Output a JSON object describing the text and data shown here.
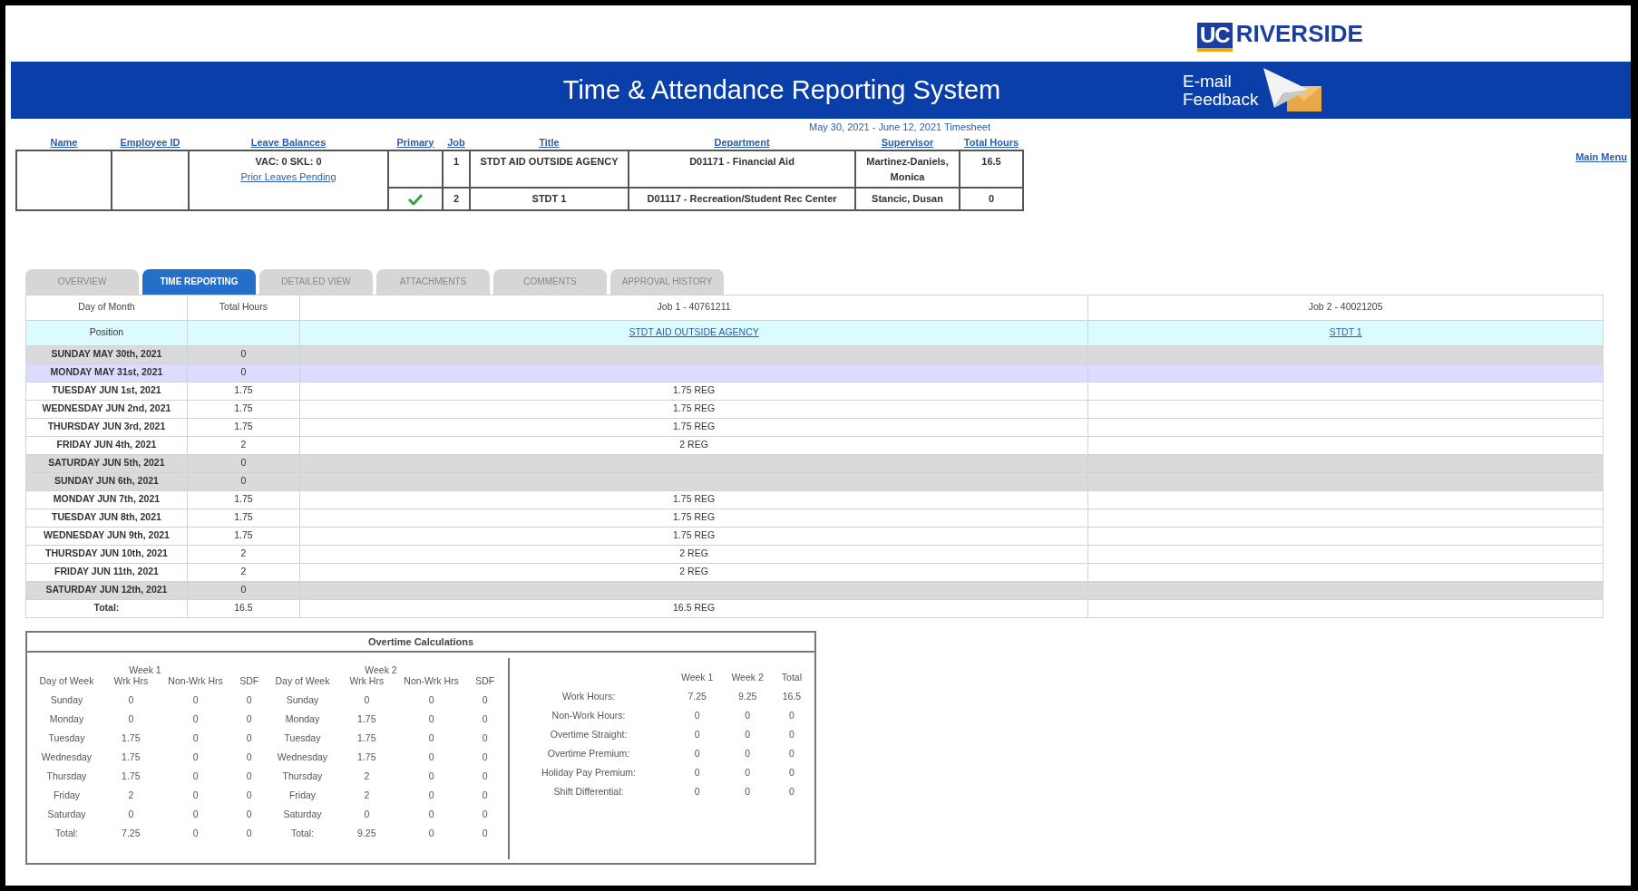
{
  "logo": {
    "mark": "UC",
    "text": "RIVERSIDE"
  },
  "banner": {
    "title": "Time & Attendance Reporting System",
    "feedback_lines": [
      "E-mail",
      "Feedback"
    ]
  },
  "period": "May 30, 2021 - June 12, 2021 Timesheet",
  "main_menu": "Main Menu",
  "employee": {
    "columns": [
      "Name",
      "Employee ID",
      "Leave Balances",
      "Primary",
      "Job",
      "Title",
      "Department",
      "Supervisor",
      "Total Hours"
    ],
    "leave_balances": {
      "text": "VAC: 0  SKL: 0",
      "link": "Prior Leaves Pending"
    },
    "jobs": [
      {
        "primary": false,
        "job": "1",
        "title": "STDT AID OUTSIDE AGENCY",
        "department": "D01171 - Financial Aid",
        "supervisor": "Martinez-Daniels, Monica",
        "total_hours": "16.5"
      },
      {
        "primary": true,
        "job": "2",
        "title": "STDT 1",
        "department": "D01117 - Recreation/Student Rec Center",
        "supervisor": "Stancic, Dusan",
        "total_hours": "0"
      }
    ]
  },
  "tabs": [
    {
      "label": "OVERVIEW",
      "selected": false
    },
    {
      "label": "TIME REPORTING",
      "selected": true
    },
    {
      "label": "DETAILED VIEW",
      "selected": false
    },
    {
      "label": "ATTACHMENTS",
      "selected": false
    },
    {
      "label": "COMMENTS",
      "selected": false
    },
    {
      "label": "APPROVAL HISTORY",
      "selected": false
    }
  ],
  "time_table": {
    "columns": [
      "Day of Month",
      "Total Hours",
      "Job 1 - 40761211",
      "Job 2 - 40021205"
    ],
    "position_row": {
      "label": "Position",
      "jobs": [
        "STDT AID OUTSIDE AGENCY",
        "STDT 1"
      ]
    },
    "rows": [
      {
        "day": "SUNDAY MAY 30th, 2021",
        "total": "0",
        "kind": "weekend",
        "selected": false
      },
      {
        "day": "MONDAY MAY 31st, 2021",
        "total": "0",
        "kind": "weekday",
        "selected": true
      },
      {
        "day": "TUESDAY JUN 1st, 2021",
        "total": "1.75",
        "job_1": "1.75 REG",
        "kind": "weekday",
        "selected": false
      },
      {
        "day": "WEDNESDAY JUN 2nd, 2021",
        "total": "1.75",
        "job_1": "1.75 REG",
        "kind": "weekday",
        "selected": false
      },
      {
        "day": "THURSDAY JUN 3rd, 2021",
        "total": "1.75",
        "job_1": "1.75 REG",
        "kind": "weekday",
        "selected": false
      },
      {
        "day": "FRIDAY JUN 4th, 2021",
        "total": "2",
        "job_1": "2 REG",
        "kind": "weekday",
        "selected": false
      },
      {
        "day": "SATURDAY JUN 5th, 2021",
        "total": "0",
        "kind": "weekend",
        "selected": false
      },
      {
        "day": "SUNDAY JUN 6th, 2021",
        "total": "0",
        "kind": "weekend",
        "selected": false
      },
      {
        "day": "MONDAY JUN 7th, 2021",
        "total": "1.75",
        "job_1": "1.75 REG",
        "kind": "weekday",
        "selected": false
      },
      {
        "day": "TUESDAY JUN 8th, 2021",
        "total": "1.75",
        "job_1": "1.75 REG",
        "kind": "weekday",
        "selected": false
      },
      {
        "day": "WEDNESDAY JUN 9th, 2021",
        "total": "1.75",
        "job_1": "1.75 REG",
        "kind": "weekday",
        "selected": false
      },
      {
        "day": "THURSDAY JUN 10th, 2021",
        "total": "2",
        "job_1": "2 REG",
        "kind": "weekday",
        "selected": false
      },
      {
        "day": "FRIDAY JUN 11th, 2021",
        "total": "2",
        "job_1": "2 REG",
        "kind": "weekday",
        "selected": false
      },
      {
        "day": "SATURDAY JUN 12th, 2021",
        "total": "0",
        "kind": "weekend",
        "selected": false
      }
    ],
    "total_row": {
      "label": "Total:",
      "total": "16.5",
      "job_1": "16.5 REG"
    }
  },
  "overtime": {
    "title": "Overtime Calculations",
    "weeks": [
      {
        "label": "Week 1",
        "columns": [
          "Day of Week",
          "Wrk Hrs",
          "Non-Wrk Hrs",
          "SDF"
        ],
        "rows": [
          [
            "Sunday",
            "0",
            "0",
            "0"
          ],
          [
            "Monday",
            "0",
            "0",
            "0"
          ],
          [
            "Tuesday",
            "1.75",
            "0",
            "0"
          ],
          [
            "Wednesday",
            "1.75",
            "0",
            "0"
          ],
          [
            "Thursday",
            "1.75",
            "0",
            "0"
          ],
          [
            "Friday",
            "2",
            "0",
            "0"
          ],
          [
            "Saturday",
            "0",
            "0",
            "0"
          ],
          [
            "Total:",
            "7.25",
            "0",
            "0"
          ]
        ]
      },
      {
        "label": "Week 2",
        "columns": [
          "Day of Week",
          "Wrk Hrs",
          "Non-Wrk Hrs",
          "SDF"
        ],
        "rows": [
          [
            "Sunday",
            "0",
            "0",
            "0"
          ],
          [
            "Monday",
            "1.75",
            "0",
            "0"
          ],
          [
            "Tuesday",
            "1.75",
            "0",
            "0"
          ],
          [
            "Wednesday",
            "1.75",
            "0",
            "0"
          ],
          [
            "Thursday",
            "2",
            "0",
            "0"
          ],
          [
            "Friday",
            "2",
            "0",
            "0"
          ],
          [
            "Saturday",
            "0",
            "0",
            "0"
          ],
          [
            "Total:",
            "9.25",
            "0",
            "0"
          ]
        ]
      }
    ],
    "summary": {
      "columns": [
        "Week 1",
        "Week 2",
        "Total"
      ],
      "rows": [
        {
          "label": "Work Hours:",
          "values": [
            "7.25",
            "9.25",
            "16.5"
          ]
        },
        {
          "label": "Non-Work Hours:",
          "values": [
            "0",
            "0",
            "0"
          ]
        },
        {
          "label": "Overtime Straight:",
          "values": [
            "0",
            "0",
            "0"
          ]
        },
        {
          "label": "Overtime Premium:",
          "values": [
            "0",
            "0",
            "0"
          ]
        },
        {
          "label": "Holiday Pay Premium:",
          "values": [
            "0",
            "0",
            "0"
          ]
        },
        {
          "label": "Shift Differential:",
          "values": [
            "0",
            "0",
            "0"
          ]
        }
      ]
    }
  }
}
